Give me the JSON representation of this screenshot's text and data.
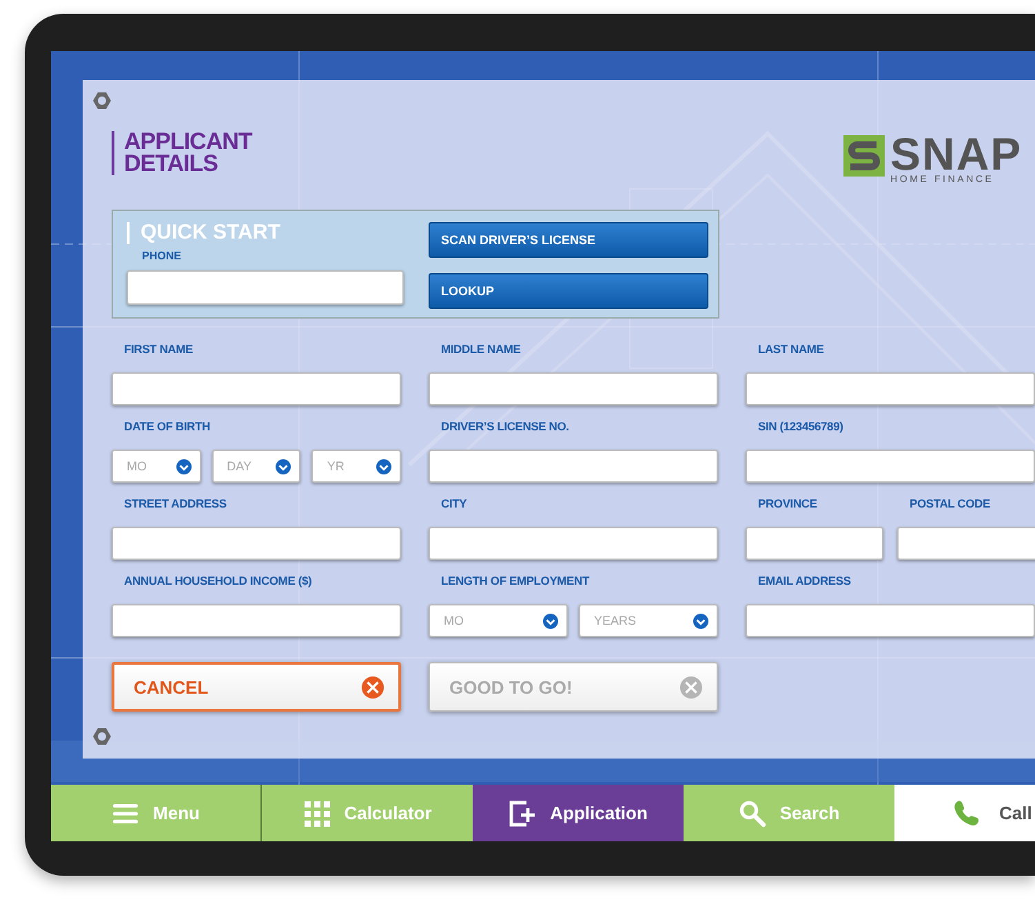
{
  "title": "APPLICANT DETAILS",
  "logo": {
    "name": "SNAP",
    "tagline": "HOME FINANCE"
  },
  "quick_start": {
    "title": "QUICK START",
    "phone_label": "PHONE",
    "buttons": [
      "SCAN DRIVER’S LICENSE",
      "LOOKUP"
    ]
  },
  "form_rows": [
    [
      {
        "kind": "text",
        "label": "FIRST NAME"
      },
      {
        "kind": "text",
        "label": "MIDDLE NAME"
      },
      {
        "kind": "text",
        "label": "LAST NAME"
      }
    ],
    [
      {
        "kind": "selects",
        "label": "DATE OF BIRTH",
        "selects": [
          {
            "placeholder": "MO"
          },
          {
            "placeholder": "DAY"
          },
          {
            "placeholder": "YR"
          }
        ]
      },
      {
        "kind": "text",
        "label": "DRIVER’S LICENSE NO."
      },
      {
        "kind": "text",
        "label": "SIN (123456789)"
      }
    ],
    [
      {
        "kind": "text",
        "label": "STREET ADDRESS"
      },
      {
        "kind": "text",
        "label": "CITY"
      },
      {
        "kind": "pair",
        "fields": [
          {
            "kind": "text",
            "label": "PROVINCE"
          },
          {
            "kind": "text",
            "label": "POSTAL CODE"
          }
        ]
      }
    ],
    [
      {
        "kind": "text",
        "label": "ANNUAL HOUSEHOLD INCOME ($)"
      },
      {
        "kind": "selects",
        "label": "LENGTH OF EMPLOYMENT",
        "selects": [
          {
            "placeholder": "MO"
          },
          {
            "placeholder": "YEARS"
          }
        ]
      },
      {
        "kind": "text",
        "label": "EMAIL ADDRESS"
      }
    ]
  ],
  "actions": [
    {
      "kind": "cancel",
      "label": "CANCEL",
      "disabled": false
    },
    {
      "kind": "submit",
      "label": "GOOD TO GO!",
      "disabled": true
    }
  ],
  "nav": [
    {
      "kind": "menu",
      "label": "Menu",
      "selected": false
    },
    {
      "kind": "calculator",
      "label": "Calculator",
      "selected": false
    },
    {
      "kind": "application",
      "label": "Application",
      "selected": true
    },
    {
      "kind": "search",
      "label": "Search",
      "selected": false
    },
    {
      "kind": "call",
      "label": "Call",
      "selected": false
    }
  ]
}
